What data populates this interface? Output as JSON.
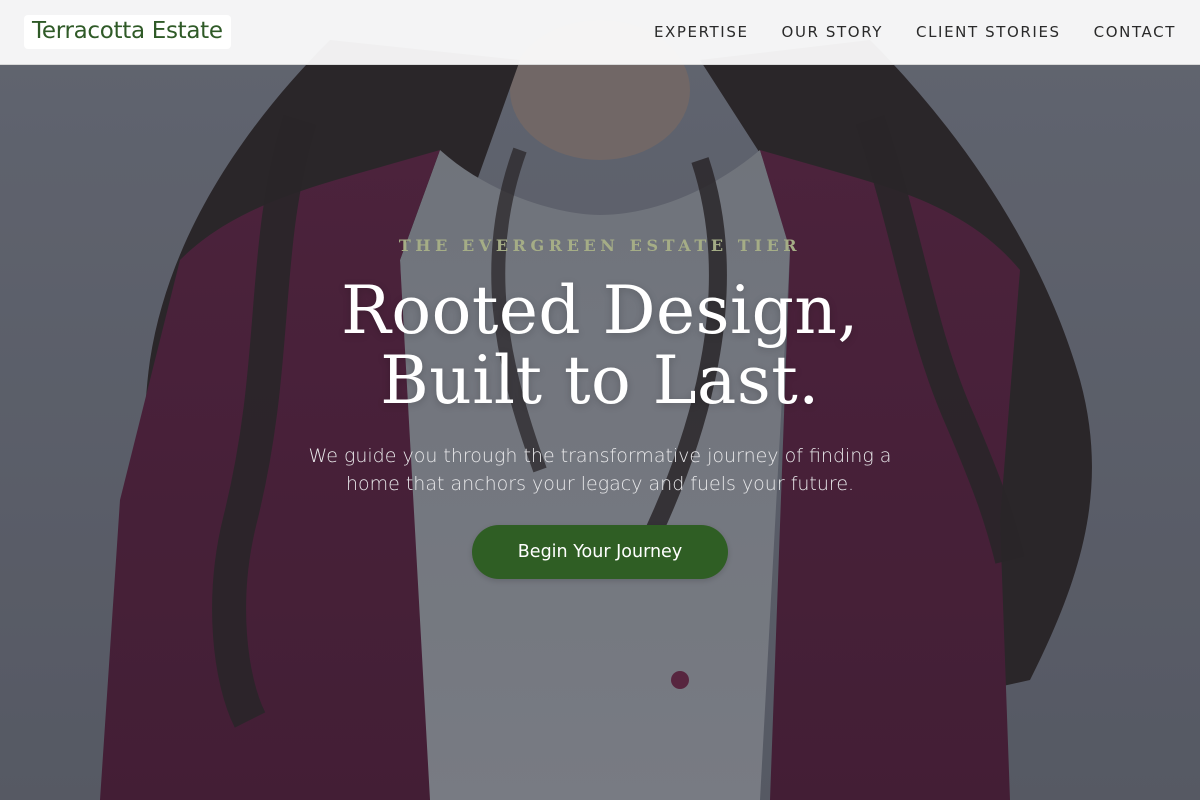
{
  "header": {
    "brand": "Terracotta Estate",
    "nav": [
      {
        "label": "EXPERTISE"
      },
      {
        "label": "OUR STORY"
      },
      {
        "label": "CLIENT STORIES"
      },
      {
        "label": "CONTACT"
      }
    ]
  },
  "hero": {
    "eyebrow": "THE EVERGREEN ESTATE TIER",
    "headline_line1": "Rooted Design,",
    "headline_line2": "Built to Last.",
    "subtext": "We guide you through the transformative journey of finding a home that anchors your legacy and fuels your future.",
    "cta_label": "Begin Your Journey",
    "background_image": "portrait of a woman with long dark wavy hair wearing a plum cardigan over a light grey knit top"
  },
  "colors": {
    "brand_green": "#2f5a27",
    "cta_green": "#2f5e24",
    "eyebrow_sage": "#a5ad86",
    "cardigan_plum": "#5b2141",
    "backdrop_grey": "#6f7280"
  }
}
